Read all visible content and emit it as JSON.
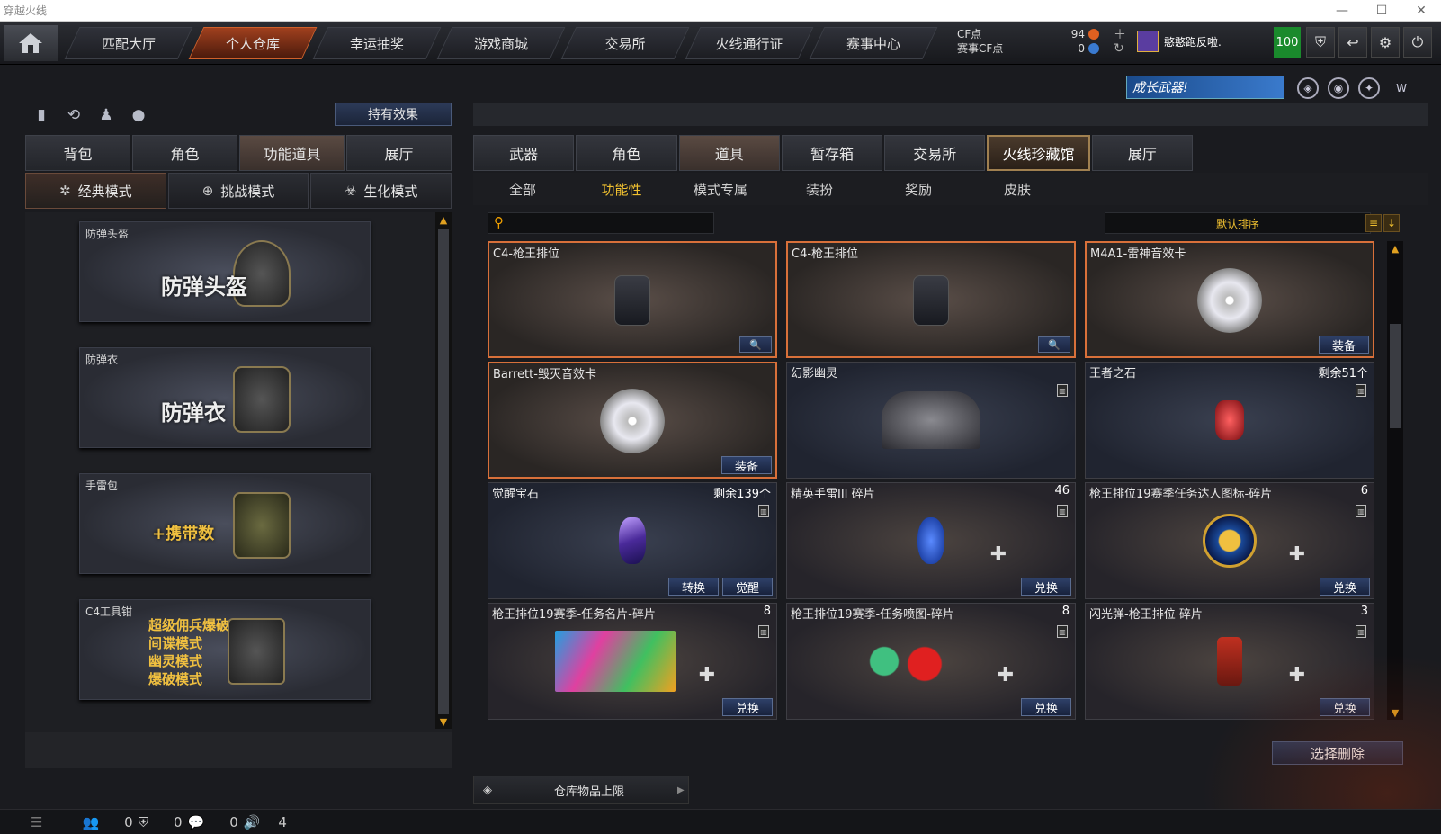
{
  "window": {
    "title": "穿越火线",
    "min": "—",
    "max": "☐",
    "close": "✕"
  },
  "nav": [
    "匹配大厅",
    "个人仓库",
    "幸运抽奖",
    "游戏商城",
    "交易所",
    "火线通行证",
    "赛事中心"
  ],
  "currency": {
    "cf_label": "CF点",
    "event_label": "赛事CF点",
    "cf_value": "94",
    "event_value": "0"
  },
  "user": {
    "name": "憨憨跑反啦.",
    "level": "100"
  },
  "banner": {
    "text": "成长武器!"
  },
  "left": {
    "effect_button": "持有效果",
    "tabs": [
      "背包",
      "角色",
      "功能道具",
      "展厅"
    ],
    "modes": [
      "经典模式",
      "挑战模式",
      "生化模式"
    ],
    "cards": [
      {
        "caption": "防弹头盔",
        "big": "防弹头盔"
      },
      {
        "caption": "防弹衣",
        "big": "防弹衣"
      },
      {
        "caption": "手雷包",
        "big": "+携带数"
      },
      {
        "caption": "C4工具钳",
        "lines": [
          "超级佣兵爆破",
          "间谍模式",
          "幽灵模式",
          "爆破模式"
        ]
      }
    ]
  },
  "right": {
    "tabs": [
      "武器",
      "角色",
      "道具",
      "暂存箱",
      "交易所",
      "火线珍藏馆",
      "展厅"
    ],
    "subtabs": [
      "全部",
      "功能性",
      "模式专属",
      "装扮",
      "奖励",
      "皮肤"
    ],
    "sort_label": "默认排序",
    "items": [
      {
        "name": "C4-枪王排位",
        "count": "",
        "button": "🔍"
      },
      {
        "name": "C4-枪王排位",
        "count": "",
        "button": "🔍"
      },
      {
        "name": "M4A1-雷神音效卡",
        "count": "",
        "button": "装备"
      },
      {
        "name": "Barrett-毁灭音效卡",
        "count": "",
        "button": "装备"
      },
      {
        "name": "幻影幽灵",
        "count": "",
        "button": ""
      },
      {
        "name": "王者之石",
        "count": "剩余51个",
        "button": ""
      },
      {
        "name": "觉醒宝石",
        "count": "剩余139个",
        "button": "觉醒",
        "button2": "转换"
      },
      {
        "name": "精英手雷III 碎片",
        "count": "46",
        "button": "兑换"
      },
      {
        "name": "枪王排位19赛季任务达人图标-碎片",
        "count": "6",
        "button": "兑换"
      },
      {
        "name": "枪王排位19赛季-任务名片-碎片",
        "count": "8",
        "button": "兑换"
      },
      {
        "name": "枪王排位19赛季-任务喷图-碎片",
        "count": "8",
        "button": "兑换"
      },
      {
        "name": "闪光弹-枪王排位 碎片",
        "count": "3",
        "button": "兑换"
      }
    ],
    "delete_button": "选择删除",
    "capacity_label": "仓库物品上限"
  },
  "status": {
    "a": "0",
    "b": "0",
    "c": "0",
    "d": "4"
  }
}
